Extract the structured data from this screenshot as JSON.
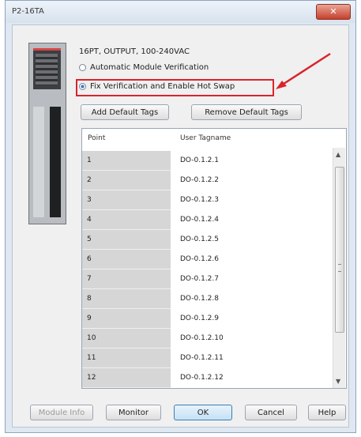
{
  "window": {
    "title": "P2-16TA",
    "close_glyph": "✕"
  },
  "module": {
    "description": "16PT, OUTPUT, 100-240VAC"
  },
  "options": [
    {
      "label": "Automatic Module Verification",
      "selected": false
    },
    {
      "label": "Fix Verification and Enable Hot Swap",
      "selected": true
    }
  ],
  "buttons": {
    "add_default_tags": "Add Default Tags",
    "remove_default_tags": "Remove Default Tags",
    "module_info": "Module Info",
    "monitor": "Monitor",
    "ok": "OK",
    "cancel": "Cancel",
    "help": "Help"
  },
  "grid": {
    "columns": [
      "Point",
      "User Tagname"
    ],
    "rows": [
      {
        "point": "1",
        "tag": "DO-0.1.2.1"
      },
      {
        "point": "2",
        "tag": "DO-0.1.2.2"
      },
      {
        "point": "3",
        "tag": "DO-0.1.2.3"
      },
      {
        "point": "4",
        "tag": "DO-0.1.2.4"
      },
      {
        "point": "5",
        "tag": "DO-0.1.2.5"
      },
      {
        "point": "6",
        "tag": "DO-0.1.2.6"
      },
      {
        "point": "7",
        "tag": "DO-0.1.2.7"
      },
      {
        "point": "8",
        "tag": "DO-0.1.2.8"
      },
      {
        "point": "9",
        "tag": "DO-0.1.2.9"
      },
      {
        "point": "10",
        "tag": "DO-0.1.2.10"
      },
      {
        "point": "11",
        "tag": "DO-0.1.2.11"
      },
      {
        "point": "12",
        "tag": "DO-0.1.2.12"
      }
    ]
  },
  "icons": {
    "scroll_up": "chevron-up-icon",
    "scroll_down": "chevron-down-icon",
    "annotation": "red-arrow-icon"
  },
  "colors": {
    "annotation": "#d9242b",
    "ok_button_border": "#3c7fb1"
  }
}
